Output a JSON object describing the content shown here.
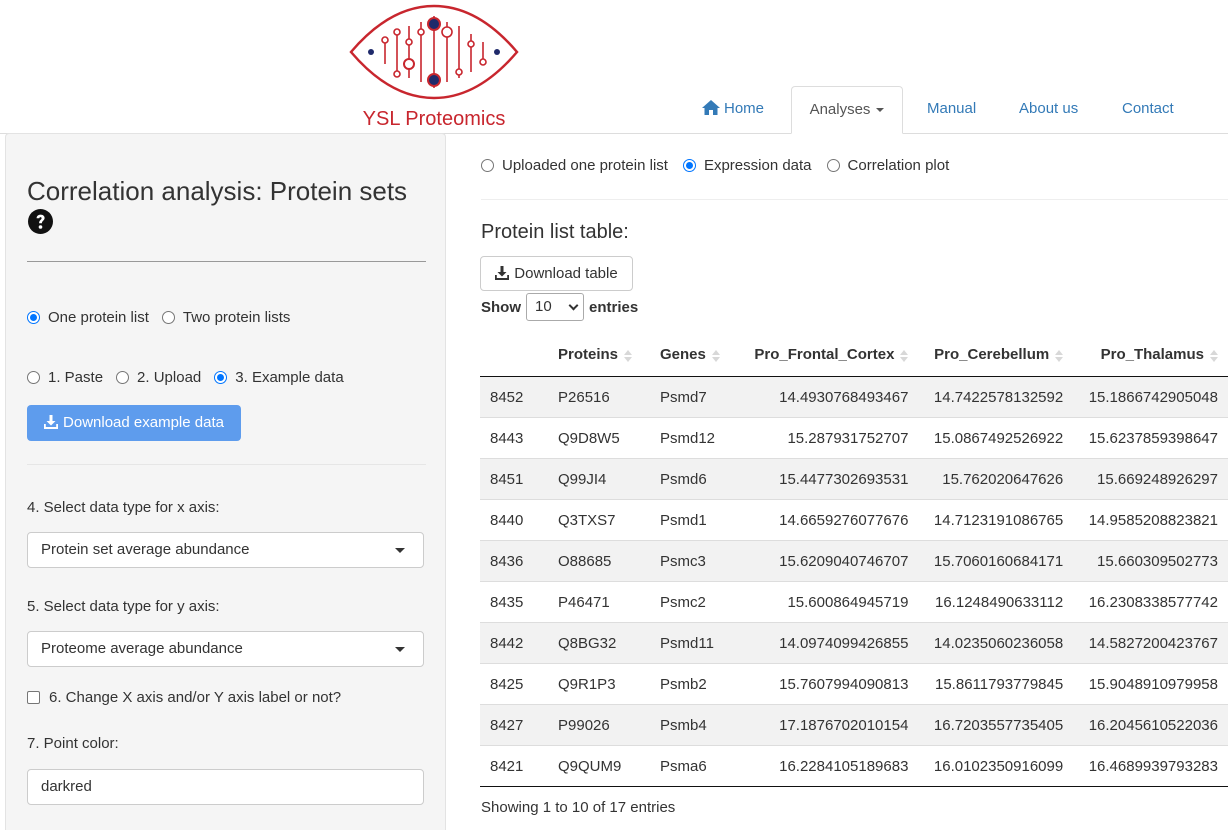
{
  "brand": {
    "logo_text": "YSL Proteomics",
    "accent": "#c8262e"
  },
  "nav": {
    "home": "Home",
    "analyses": "Analyses",
    "manual": "Manual",
    "about": "About us",
    "contact": "Contact",
    "active": "Analyses"
  },
  "sidebar": {
    "title": "Correlation analysis: Protein sets",
    "list_options": [
      {
        "label": "One protein list",
        "selected": true
      },
      {
        "label": "Two protein lists",
        "selected": false
      }
    ],
    "input_options": [
      {
        "label": "1. Paste",
        "selected": false
      },
      {
        "label": "2. Upload",
        "selected": false
      },
      {
        "label": "3. Example data",
        "selected": true
      }
    ],
    "download_example_label": "Download example data",
    "x_axis_label": "4. Select data type for x axis:",
    "x_axis_value": "Protein set average abundance",
    "y_axis_label": "5. Select data type for y axis:",
    "y_axis_value": "Proteome average abundance",
    "change_label_checkbox": "6. Change X axis and/or Y axis label or not?",
    "change_label_checked": false,
    "point_color_label": "7. Point color:",
    "point_color_value": "darkred"
  },
  "main": {
    "view_options": [
      {
        "label": "Uploaded one protein list",
        "selected": false
      },
      {
        "label": "Expression data",
        "selected": true
      },
      {
        "label": "Correlation plot",
        "selected": false
      }
    ],
    "section_title": "Protein list table:",
    "download_table_label": "Download table",
    "show_label": "Show",
    "entries_value": "10",
    "entries_label": "entries",
    "table": {
      "columns": [
        "",
        "Proteins",
        "Genes",
        "Pro_Frontal_Cortex",
        "Pro_Cerebellum",
        "Pro_Thalamus"
      ],
      "rows": [
        [
          "8452",
          "P26516",
          "Psmd7",
          "14.4930768493467",
          "14.7422578132592",
          "15.1866742905048"
        ],
        [
          "8443",
          "Q9D8W5",
          "Psmd12",
          "15.287931752707",
          "15.0867492526922",
          "15.6237859398647"
        ],
        [
          "8451",
          "Q99JI4",
          "Psmd6",
          "15.4477302693531",
          "15.762020647626",
          "15.669248926297"
        ],
        [
          "8440",
          "Q3TXS7",
          "Psmd1",
          "14.6659276077676",
          "14.7123191086765",
          "14.9585208823821"
        ],
        [
          "8436",
          "O88685",
          "Psmc3",
          "15.6209040746707",
          "15.7060160684171",
          "15.660309502773"
        ],
        [
          "8435",
          "P46471",
          "Psmc2",
          "15.600864945719",
          "16.1248490633112",
          "16.2308338577742"
        ],
        [
          "8442",
          "Q8BG32",
          "Psmd11",
          "14.0974099426855",
          "14.0235060236058",
          "14.5827200423767"
        ],
        [
          "8425",
          "Q9R1P3",
          "Psmb2",
          "15.7607994090813",
          "15.8611793779845",
          "15.9048910979958"
        ],
        [
          "8427",
          "P99026",
          "Psmb4",
          "17.1876702010154",
          "16.7203557735405",
          "16.2045610522036"
        ],
        [
          "8421",
          "Q9QUM9",
          "Psma6",
          "16.2284105189683",
          "16.0102350916099",
          "16.4689939793283"
        ]
      ]
    },
    "info": "Showing 1 to 10 of 17 entries"
  }
}
